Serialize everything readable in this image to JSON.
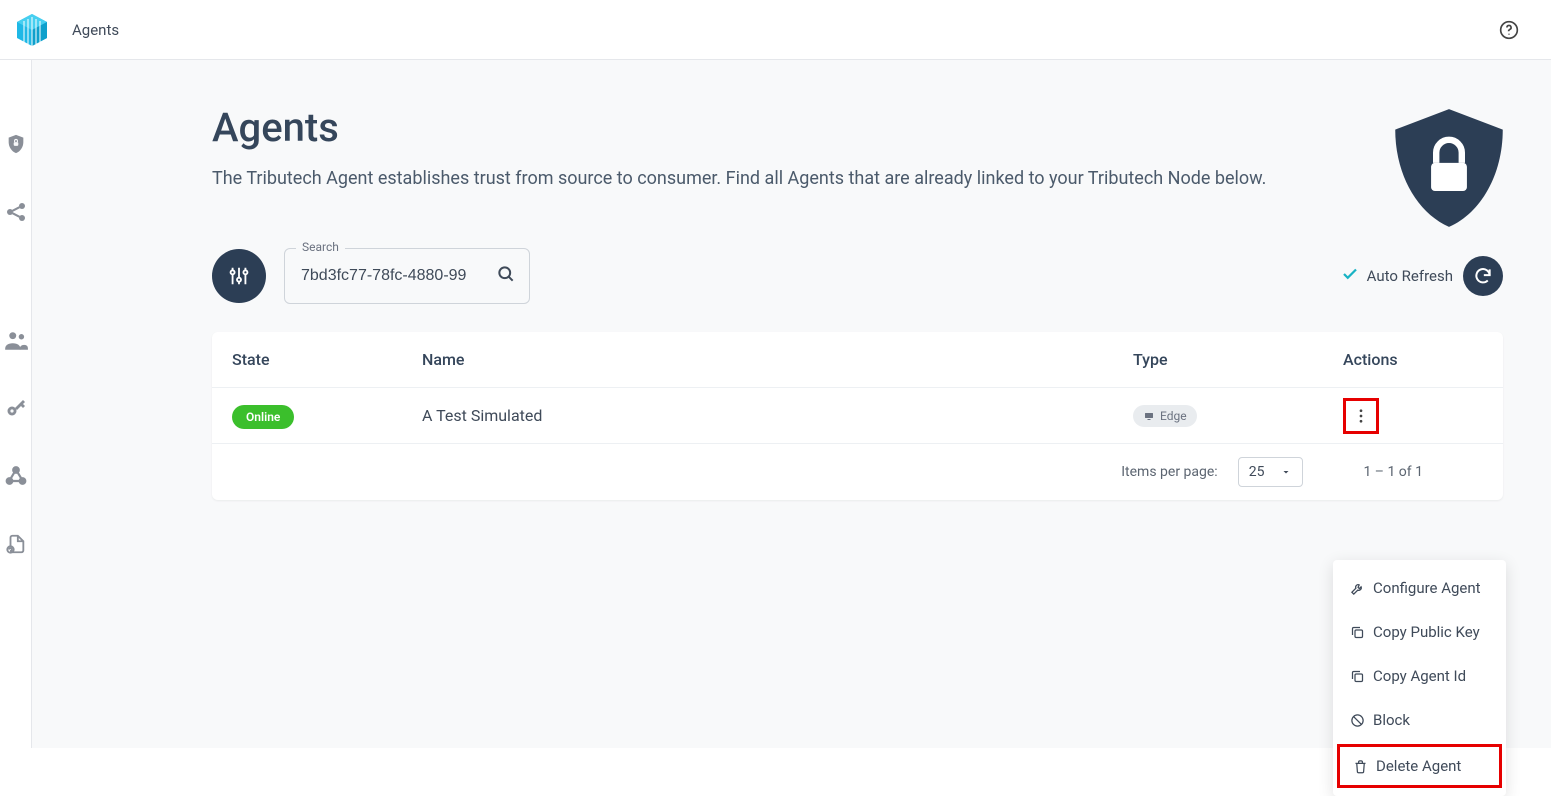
{
  "header": {
    "breadcrumb": "Agents"
  },
  "sidebar_icons": [
    "shield-lock",
    "share-nodes",
    "users",
    "key",
    "webhook",
    "file"
  ],
  "page": {
    "title": "Agents",
    "subtitle": "The Tributech Agent establishes trust from source to consumer. Find all Agents that are already linked to your Tributech Node below."
  },
  "search": {
    "label": "Search",
    "value": "7bd3fc77-78fc-4880-99"
  },
  "auto_refresh_label": "Auto Refresh",
  "table": {
    "columns": {
      "state": "State",
      "name": "Name",
      "type": "Type",
      "actions": "Actions"
    },
    "rows": [
      {
        "state": "Online",
        "name": "A Test Simulated",
        "type": "Edge"
      }
    ]
  },
  "pagination": {
    "items_per_page_label": "Items per page:",
    "items_per_page_value": "25",
    "range": "1 – 1 of 1"
  },
  "actions_menu": {
    "items": [
      {
        "icon": "wrench",
        "label": "Configure Agent"
      },
      {
        "icon": "copy",
        "label": "Copy Public Key"
      },
      {
        "icon": "copy",
        "label": "Copy Agent Id"
      },
      {
        "icon": "block",
        "label": "Block"
      },
      {
        "icon": "trash",
        "label": "Delete Agent"
      }
    ],
    "highlight_index": 4
  }
}
